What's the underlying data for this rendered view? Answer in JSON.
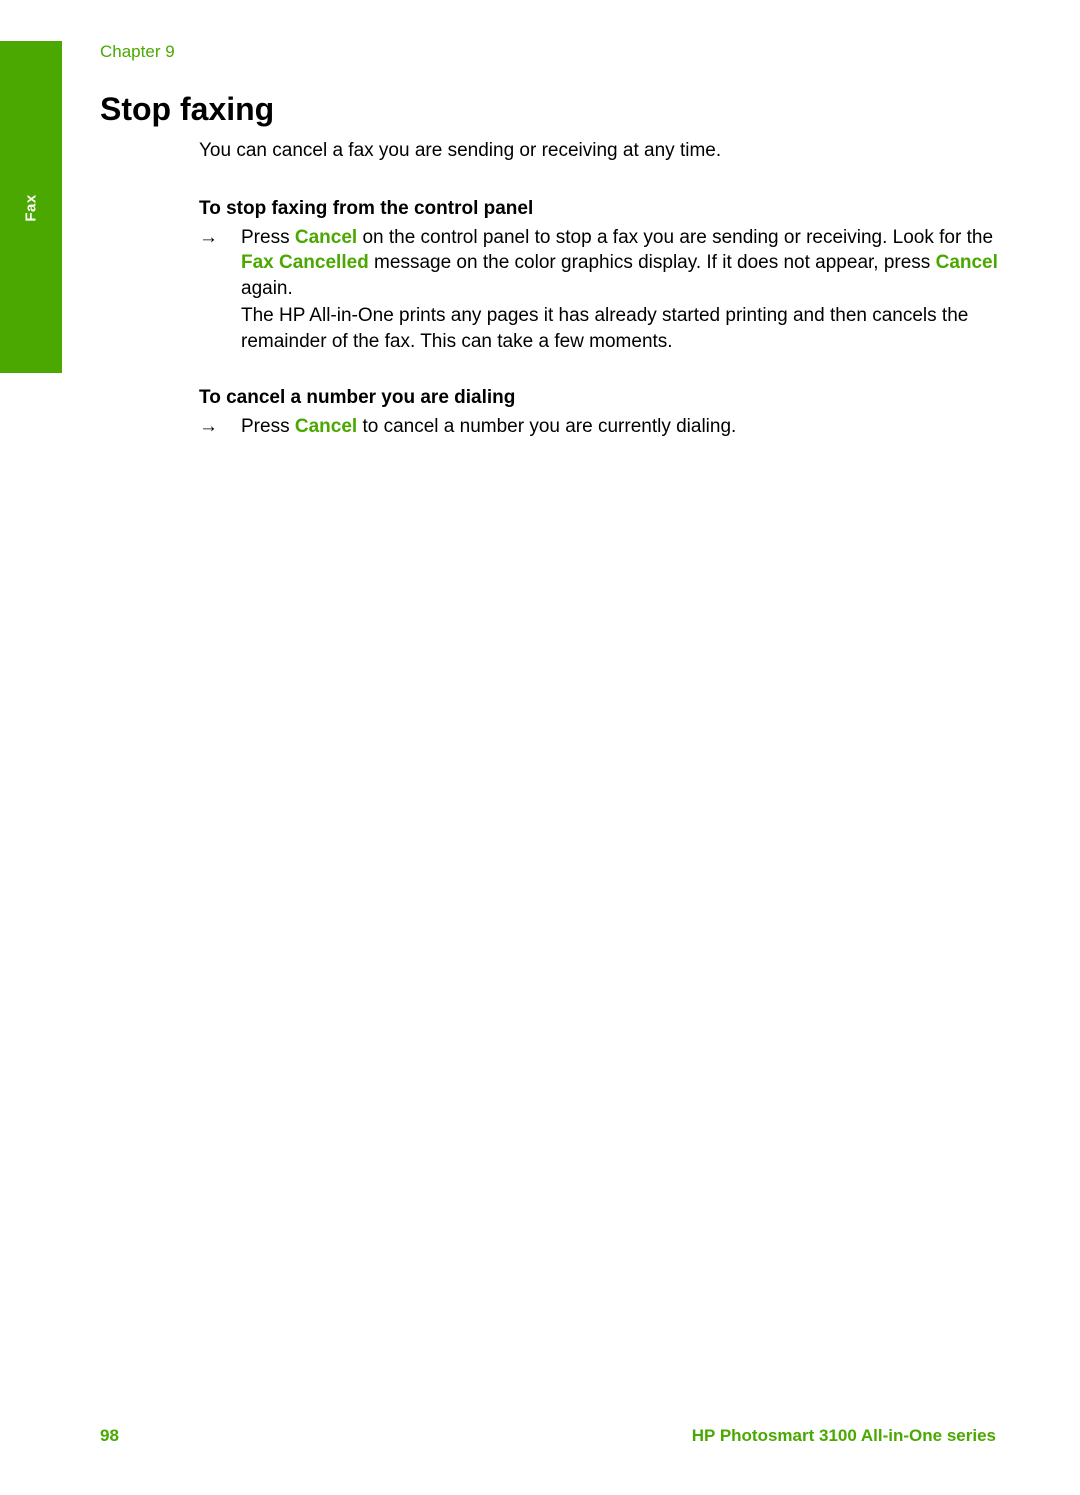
{
  "side_tab": {
    "label": "Fax",
    "color": "#4aa800"
  },
  "header": {
    "chapter": "Chapter 9"
  },
  "title": "Stop faxing",
  "intro": "You can cancel a fax you are sending or receiving at any time.",
  "sections": [
    {
      "heading": "To stop faxing from the control panel",
      "step": {
        "arrow_icon": "→",
        "p1": {
          "t1": "Press ",
          "ui1": "Cancel",
          "t2": " on the control panel to stop a fax you are sending or receiving. Look for the ",
          "ui2": "Fax Cancelled",
          "t3": " message on the color graphics display. If it does not appear, press ",
          "ui3": "Cancel",
          "t4": " again."
        },
        "p2": "The HP All-in-One prints any pages it has already started printing and then cancels the remainder of the fax. This can take a few moments."
      }
    },
    {
      "heading": "To cancel a number you are dialing",
      "step": {
        "arrow_icon": "→",
        "p1": {
          "t1": "Press ",
          "ui1": "Cancel",
          "t2": " to cancel a number you are currently dialing."
        }
      }
    }
  ],
  "footer": {
    "page_number": "98",
    "product_title": "HP Photosmart 3100 All-in-One series"
  },
  "colors": {
    "accent_green": "#4aa800",
    "text": "#000000"
  }
}
